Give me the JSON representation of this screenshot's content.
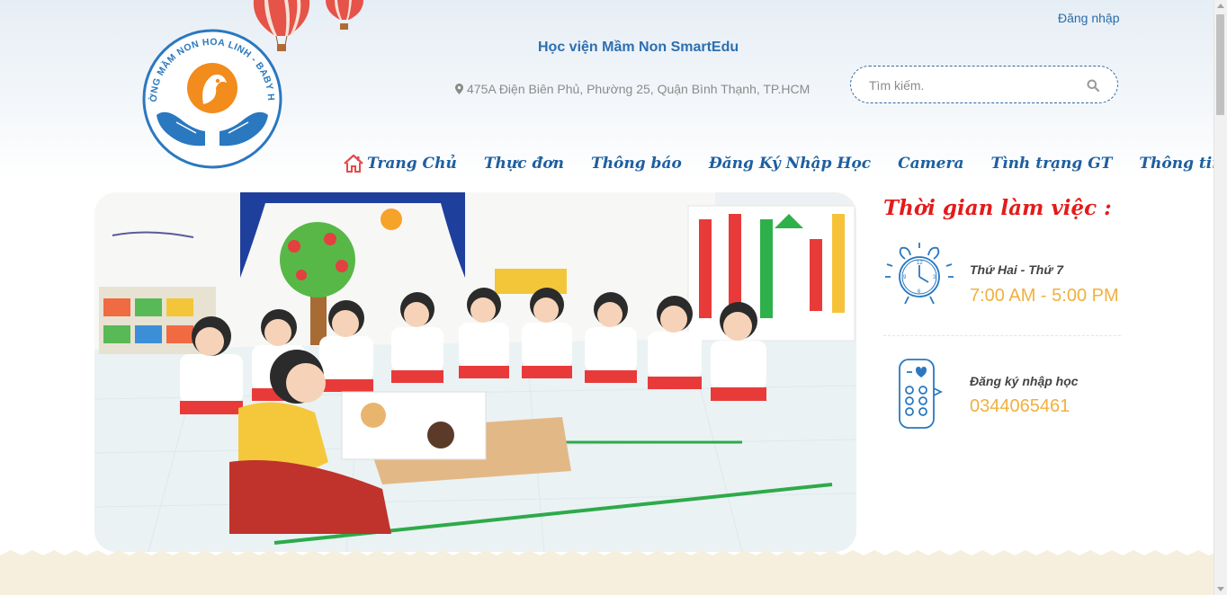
{
  "header": {
    "login_label": "Đăng nhập",
    "academy_name": "Học viện Mầm Non SmartEdu",
    "address": "475A Điện Biên Phủ, Phường 25, Quận Bình Thạnh, TP.HCM",
    "logo_text": "TRƯỜNG MẦM NON HOA LINH - BABY HOME"
  },
  "search": {
    "placeholder": "Tìm kiếm."
  },
  "nav": {
    "items": [
      {
        "label": "Trang Chủ",
        "icon": "home-icon"
      },
      {
        "label": "Thực đơn"
      },
      {
        "label": "Thông báo"
      },
      {
        "label": "Đăng Ký Nhập Học"
      },
      {
        "label": "Camera"
      },
      {
        "label": "Tình trạng GT"
      },
      {
        "label": "Thông tin bé"
      }
    ]
  },
  "hours": {
    "title": "Thời gian làm việc :",
    "days": "Thứ Hai - Thứ 7",
    "time": "7:00 AM - 5:00 PM",
    "register_label": "Đăng ký nhập học",
    "phone": "0344065461"
  },
  "colors": {
    "brand_blue": "#1e5fa0",
    "accent_red": "#e41b1b",
    "accent_gold": "#f0b03e",
    "logo_orange": "#f28c1c"
  }
}
